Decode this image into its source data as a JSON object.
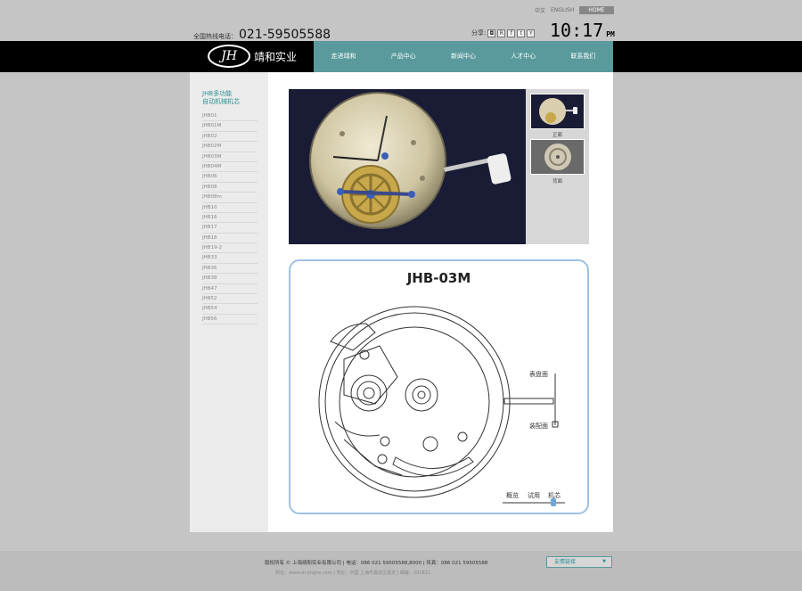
{
  "header": {
    "lang_cn": "中文",
    "lang_en": "ENGLISH",
    "home_label": "HOME",
    "hotline_label": "全国热线电话：",
    "hotline_number": "021-59505588",
    "share_label": "分享:",
    "share_icons": [
      "qq-share-icon",
      "renren-share-icon",
      "facebook-share-icon",
      "twitter-share-icon",
      "youtube-share-icon"
    ],
    "share_glyphs": [
      "◘",
      "R",
      "f",
      "t",
      "Y"
    ],
    "clock_time": "10:17",
    "clock_ampm": "PM"
  },
  "logo": {
    "mark": "JH",
    "name": "靖和实业"
  },
  "nav": [
    "走进靖和",
    "产品中心",
    "新闻中心",
    "人才中心",
    "联系我们"
  ],
  "sidebar": {
    "title_line1": "JHB多功能",
    "title_line2": "自动机械机芯",
    "items": [
      "JHB01",
      "JHB01M",
      "JHB02",
      "JHB02M",
      "JHB03M",
      "JHB04M",
      "JHB06",
      "JHB08",
      "JHB08m",
      "JHB10",
      "JHB16",
      "JHB17",
      "JHB18",
      "JHB19-2",
      "JHB33",
      "JHB36",
      "JHB38",
      "JHB47",
      "JHB52",
      "JHB54",
      "JHB56"
    ]
  },
  "gallery": {
    "front_label": "正面",
    "back_label": "背面"
  },
  "diagram": {
    "title": "JHB-03M",
    "dial_side": "表盘面",
    "case_side": "装配面",
    "tab_overview": "概览",
    "tab_fit": "试用",
    "tab_movement": "机芯"
  },
  "footer": {
    "copyright": "版权所有 © 上海靖和实业有限公司 | 电话：086 021 59505588,8000 | 传真：086 021 59505588",
    "address": "网址：www.sh-jinghe.com | 地址：中国 上海市嘉定区嘉定 | 邮编：201811",
    "links_label": "友情链接"
  },
  "colors": {
    "teal": "#5a9a9c",
    "nav_bg": "#000000",
    "diagram_border": "#9ec1e4"
  }
}
